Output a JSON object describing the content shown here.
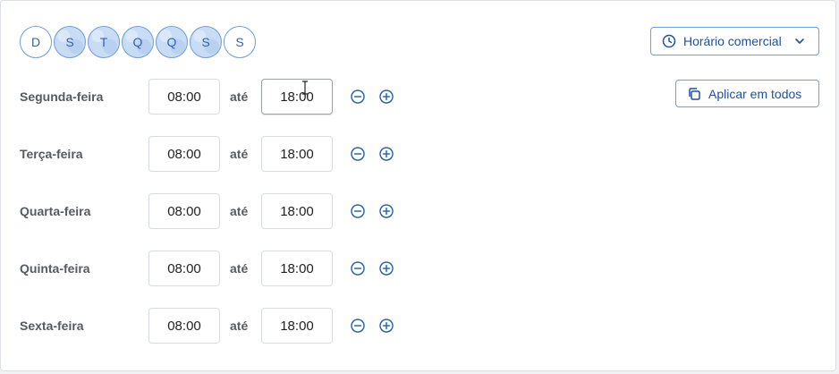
{
  "days": [
    {
      "label": "D",
      "active": false
    },
    {
      "label": "S",
      "active": true
    },
    {
      "label": "T",
      "active": true
    },
    {
      "label": "Q",
      "active": true
    },
    {
      "label": "Q",
      "active": true
    },
    {
      "label": "S",
      "active": true
    },
    {
      "label": "S",
      "active": false
    }
  ],
  "schedule_preset": {
    "label": "Horário comercial",
    "icon": "clock-icon",
    "chevron": "chevron-down-icon"
  },
  "apply_all": {
    "label": "Aplicar em todos",
    "icon": "copy-icon"
  },
  "separator": "até",
  "rows": [
    {
      "day": "Segunda-feira",
      "start": "08:00",
      "end": "18:00"
    },
    {
      "day": "Terça-feira",
      "start": "08:00",
      "end": "18:00"
    },
    {
      "day": "Quarta-feira",
      "start": "08:00",
      "end": "18:00"
    },
    {
      "day": "Quinta-feira",
      "start": "08:00",
      "end": "18:00"
    },
    {
      "day": "Sexta-feira",
      "start": "08:00",
      "end": "18:00"
    }
  ],
  "colors": {
    "accent": "#2f63b8",
    "accent_border": "#6f9ed8",
    "label": "#555b63"
  }
}
